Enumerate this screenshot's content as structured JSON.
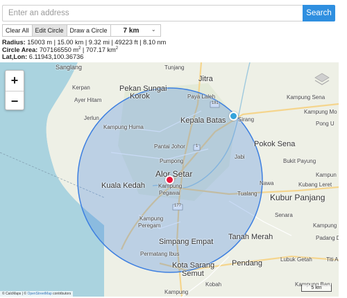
{
  "search": {
    "placeholder": "Enter an address",
    "button": "Search"
  },
  "toolbar": {
    "clear_all": "Clear All",
    "edit_circle": "Edit Circle",
    "draw_circle": "Draw a Circle",
    "radius_value": "7 km"
  },
  "info": {
    "radius_label": "Radius:",
    "radius_value": "15003 m | 15.00 km | 9.32 mi | 49223 ft | 8.10 nm",
    "area_label": "Circle Area:",
    "area_m2": "707166550 m",
    "area_sep": " | ",
    "area_km2": "707.17 km",
    "sup": "2",
    "latlon_label": "Lat,Lon:",
    "latlon_value": "6.11943,100.36736"
  },
  "map": {
    "zoom_in": "+",
    "zoom_out": "−",
    "scale_label": "5 km",
    "attribution_prefix": "© CalcMaps | © ",
    "attribution_link": "OpenStreetMap",
    "attribution_suffix": " contributors",
    "circle_color": "#3d7fe0",
    "places": {
      "sanglang": "Sanglang",
      "tunjang": "Tunjang",
      "jitra": "Jitra",
      "kerpan": "Kerpan",
      "pekan_sungai_korok": "Pekan Sungai",
      "korok": "Korok",
      "paya_laleh": "Paya Laleh",
      "ayer_hitam": "Ayer Hitam",
      "kampung_sena": "Kampung Sena",
      "jerlun": "Jerlun",
      "kepala_batas": "Kepala Batas",
      "sirang": "Sirang",
      "kampung_mo": "Kampung Mo",
      "kampung_huma": "Kampung Huma",
      "pong_u": "Pong U",
      "pokok_sena": "Pokok Sena",
      "pantai_johor": "Pantai Johor",
      "jabi": "Jabi",
      "bukit_payung": "Bukit Payung",
      "pumpong": "Pumpong",
      "alor_setar": "Alor Setar",
      "kampung_r": "Kampun",
      "kuala_kedah": "Kuala Kedah",
      "kampung_pegawai_1": "Kampung",
      "kampung_pegawai_2": "Pegawai",
      "nawa": "Nawa",
      "kubang_leret": "Kubang Leret",
      "tualang": "Tualang",
      "kubur_panjang": "Kubur Panjang",
      "senara": "Senara",
      "kampung_r2": "Kampung",
      "kampung_peregam_1": "Kampung",
      "kampung_peregam_2": "Peregam",
      "padang_d": "Padang D",
      "simpang_empat": "Simpang Empat",
      "tanah_merah": "Tanah Merah",
      "permatang_ibus": "Permatang Ibus",
      "lubuk_getah": "Lubuk Getah",
      "titi": "Titi A",
      "kota_sarang_1": "Kota Sarang",
      "kota_sarang_2": "Semut",
      "pendang": "Pendang",
      "kobah": "Kobah",
      "kampung_baru": "Kampung Baru",
      "kampung_bottom": "Kampung",
      "road_181": "181",
      "road_1": "1",
      "road_177": "177"
    }
  }
}
